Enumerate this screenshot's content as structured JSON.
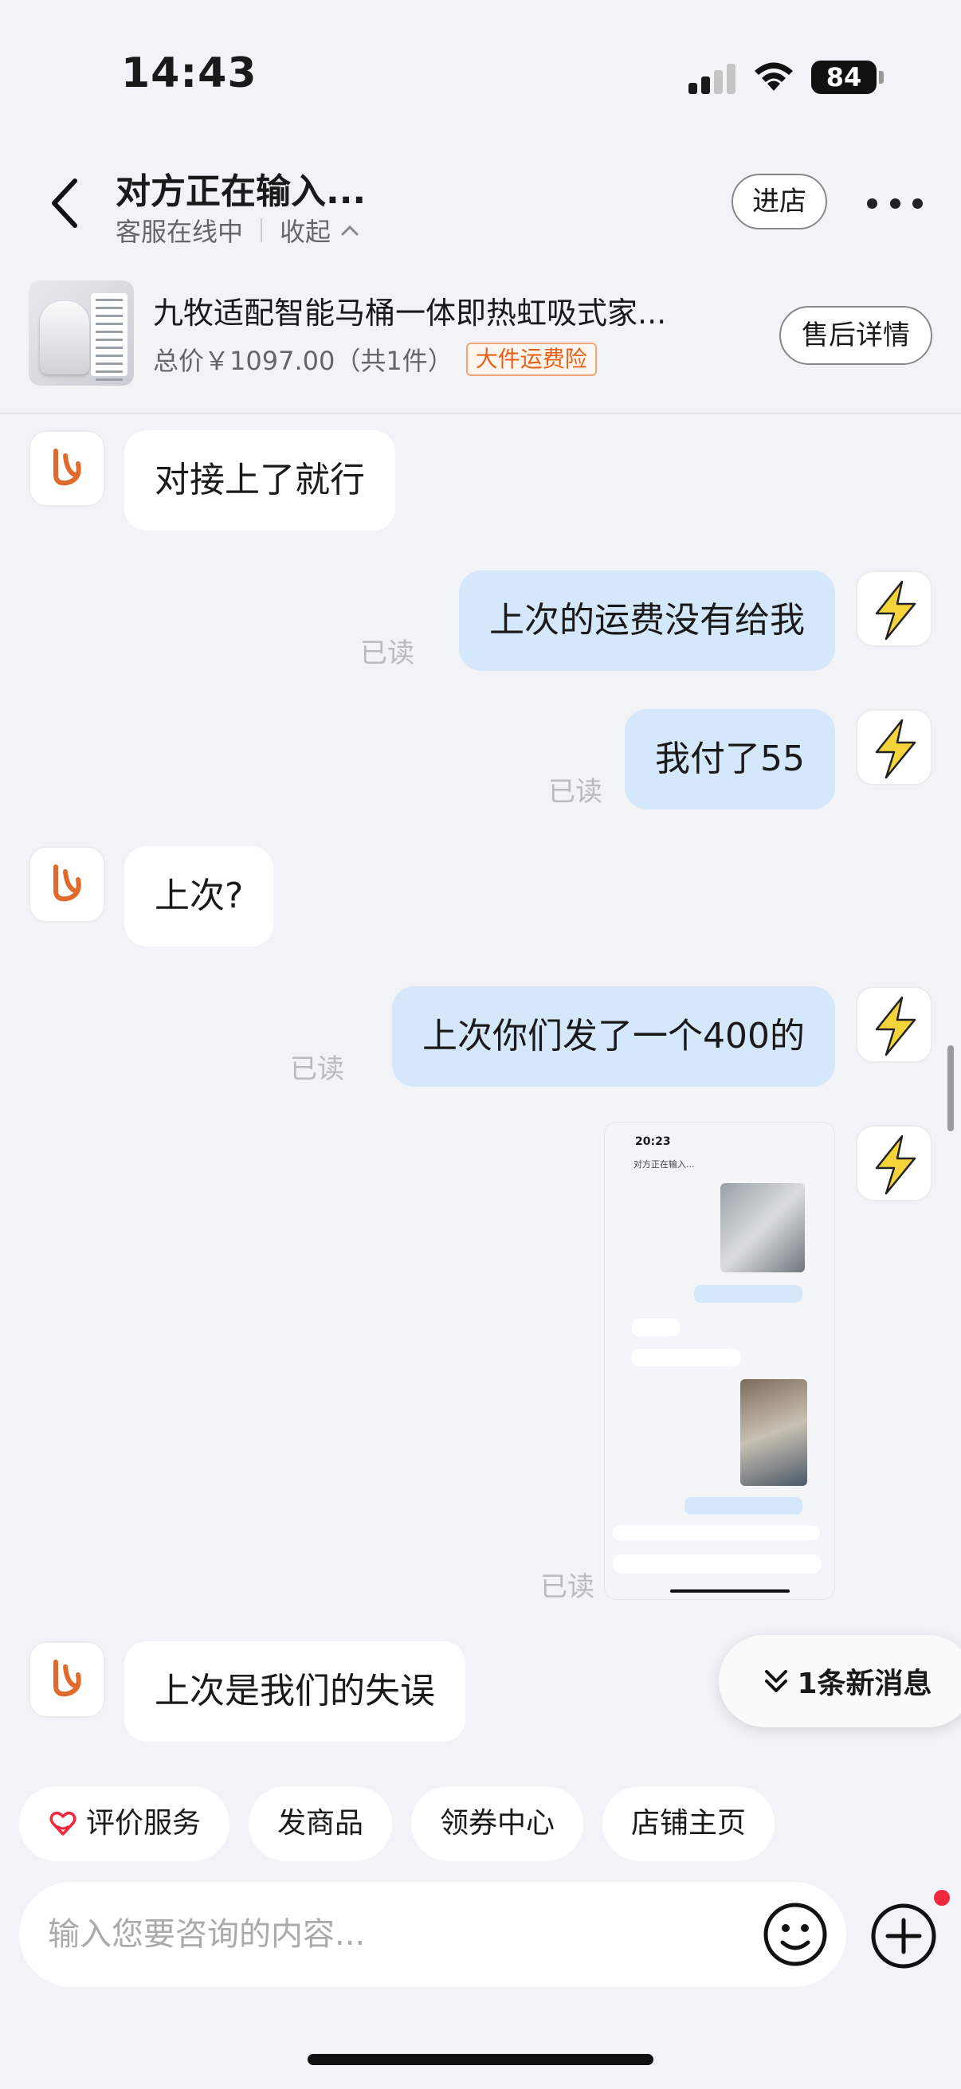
{
  "status_bar": {
    "time": "14:43",
    "battery": "84",
    "signal_icon": "cellular-signal-icon",
    "wifi_icon": "wifi-icon"
  },
  "header": {
    "title": "对方正在输入...",
    "status": "客服在线中",
    "collapse_label": "收起",
    "store_button": "进店",
    "icons": {
      "back": "chevron-left-icon",
      "more": "more-dots-icon",
      "collapse": "chevron-up-icon"
    }
  },
  "product": {
    "name": "九牧适配智能马桶一体即热虹吸式家...",
    "price": "总价￥1097.00（共1件）",
    "tag": "大件运费险",
    "aftersale_button": "售后详情",
    "tag_color": "#ec5e15"
  },
  "messages": [
    {
      "from": "store",
      "text": "对接上了就行"
    },
    {
      "from": "me",
      "text": "上次的运费没有给我",
      "status": "已读"
    },
    {
      "from": "me",
      "text": "我付了55",
      "status": "已读"
    },
    {
      "from": "store",
      "text": "上次?"
    },
    {
      "from": "me",
      "text": "上次你们发了一个400的",
      "status": "已读"
    },
    {
      "from": "me",
      "type": "image",
      "status": "已读",
      "image": {
        "time": "20:23",
        "title": "对方正在输入..."
      }
    },
    {
      "from": "store",
      "text": "上次是我们的失误"
    }
  ],
  "new_messages": {
    "label": "1条新消息",
    "icon": "double-chevron-down-icon"
  },
  "quick_actions": [
    {
      "label": "评价服务",
      "icon": "heart-hands-icon"
    },
    {
      "label": "发商品"
    },
    {
      "label": "领券中心"
    },
    {
      "label": "店铺主页"
    }
  ],
  "input": {
    "placeholder": "输入您要咨询的内容...",
    "emoji_icon": "smiley-icon",
    "plus_icon": "plus-circle-icon"
  },
  "colors": {
    "bubble_out": "#d5e7fb",
    "bubble_in": "#ffffff",
    "background": "#f2f3f7",
    "store_logo": "#e06a2c",
    "my_avatar": "#f5d33b"
  }
}
